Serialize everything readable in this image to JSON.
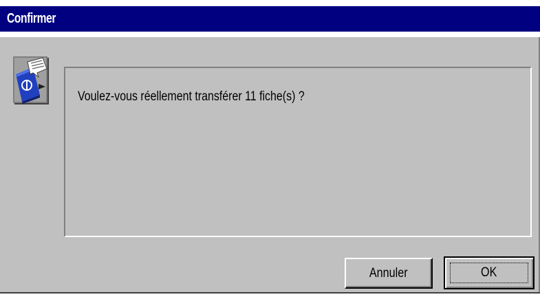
{
  "dialog": {
    "title": "Confirmer",
    "icon": "database-transfer-icon",
    "message": "Voulez-vous réellement transférer 11 fiche(s) ?"
  },
  "buttons": {
    "cancel_label": "Annuler",
    "ok_label": "OK"
  },
  "colors": {
    "titlebar": "#000080",
    "dialog_face": "#c0c0c0",
    "title_text": "#ffffff"
  }
}
